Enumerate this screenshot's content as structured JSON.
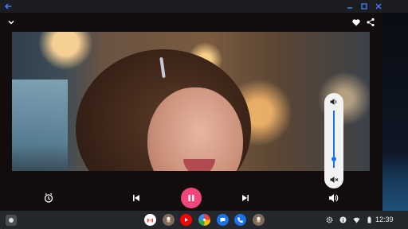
{
  "window": {
    "icons": [
      "back-arrow-icon",
      "minimize-icon",
      "maximize-icon",
      "close-icon"
    ]
  },
  "player": {
    "header_icons": [
      "chevron-down-icon",
      "heart-icon",
      "share-icon"
    ],
    "is_playing": true,
    "accent_color": "#f04979",
    "volume_popup": {
      "open": true,
      "level": 0.15,
      "icons": [
        "volume-up-icon",
        "volume-mute-icon"
      ]
    },
    "controls": [
      "timer-icon",
      "skip-previous-icon",
      "pause-icon",
      "skip-next-icon",
      "volume-icon"
    ]
  },
  "shelf": {
    "apps": [
      "gmail",
      "cooking-app",
      "youtube",
      "google-photos",
      "messages",
      "phone",
      "cooking-app"
    ],
    "clock": "12:39",
    "tray_icons": [
      "settings-icon",
      "info-icon",
      "wifi-icon",
      "battery-icon"
    ]
  }
}
